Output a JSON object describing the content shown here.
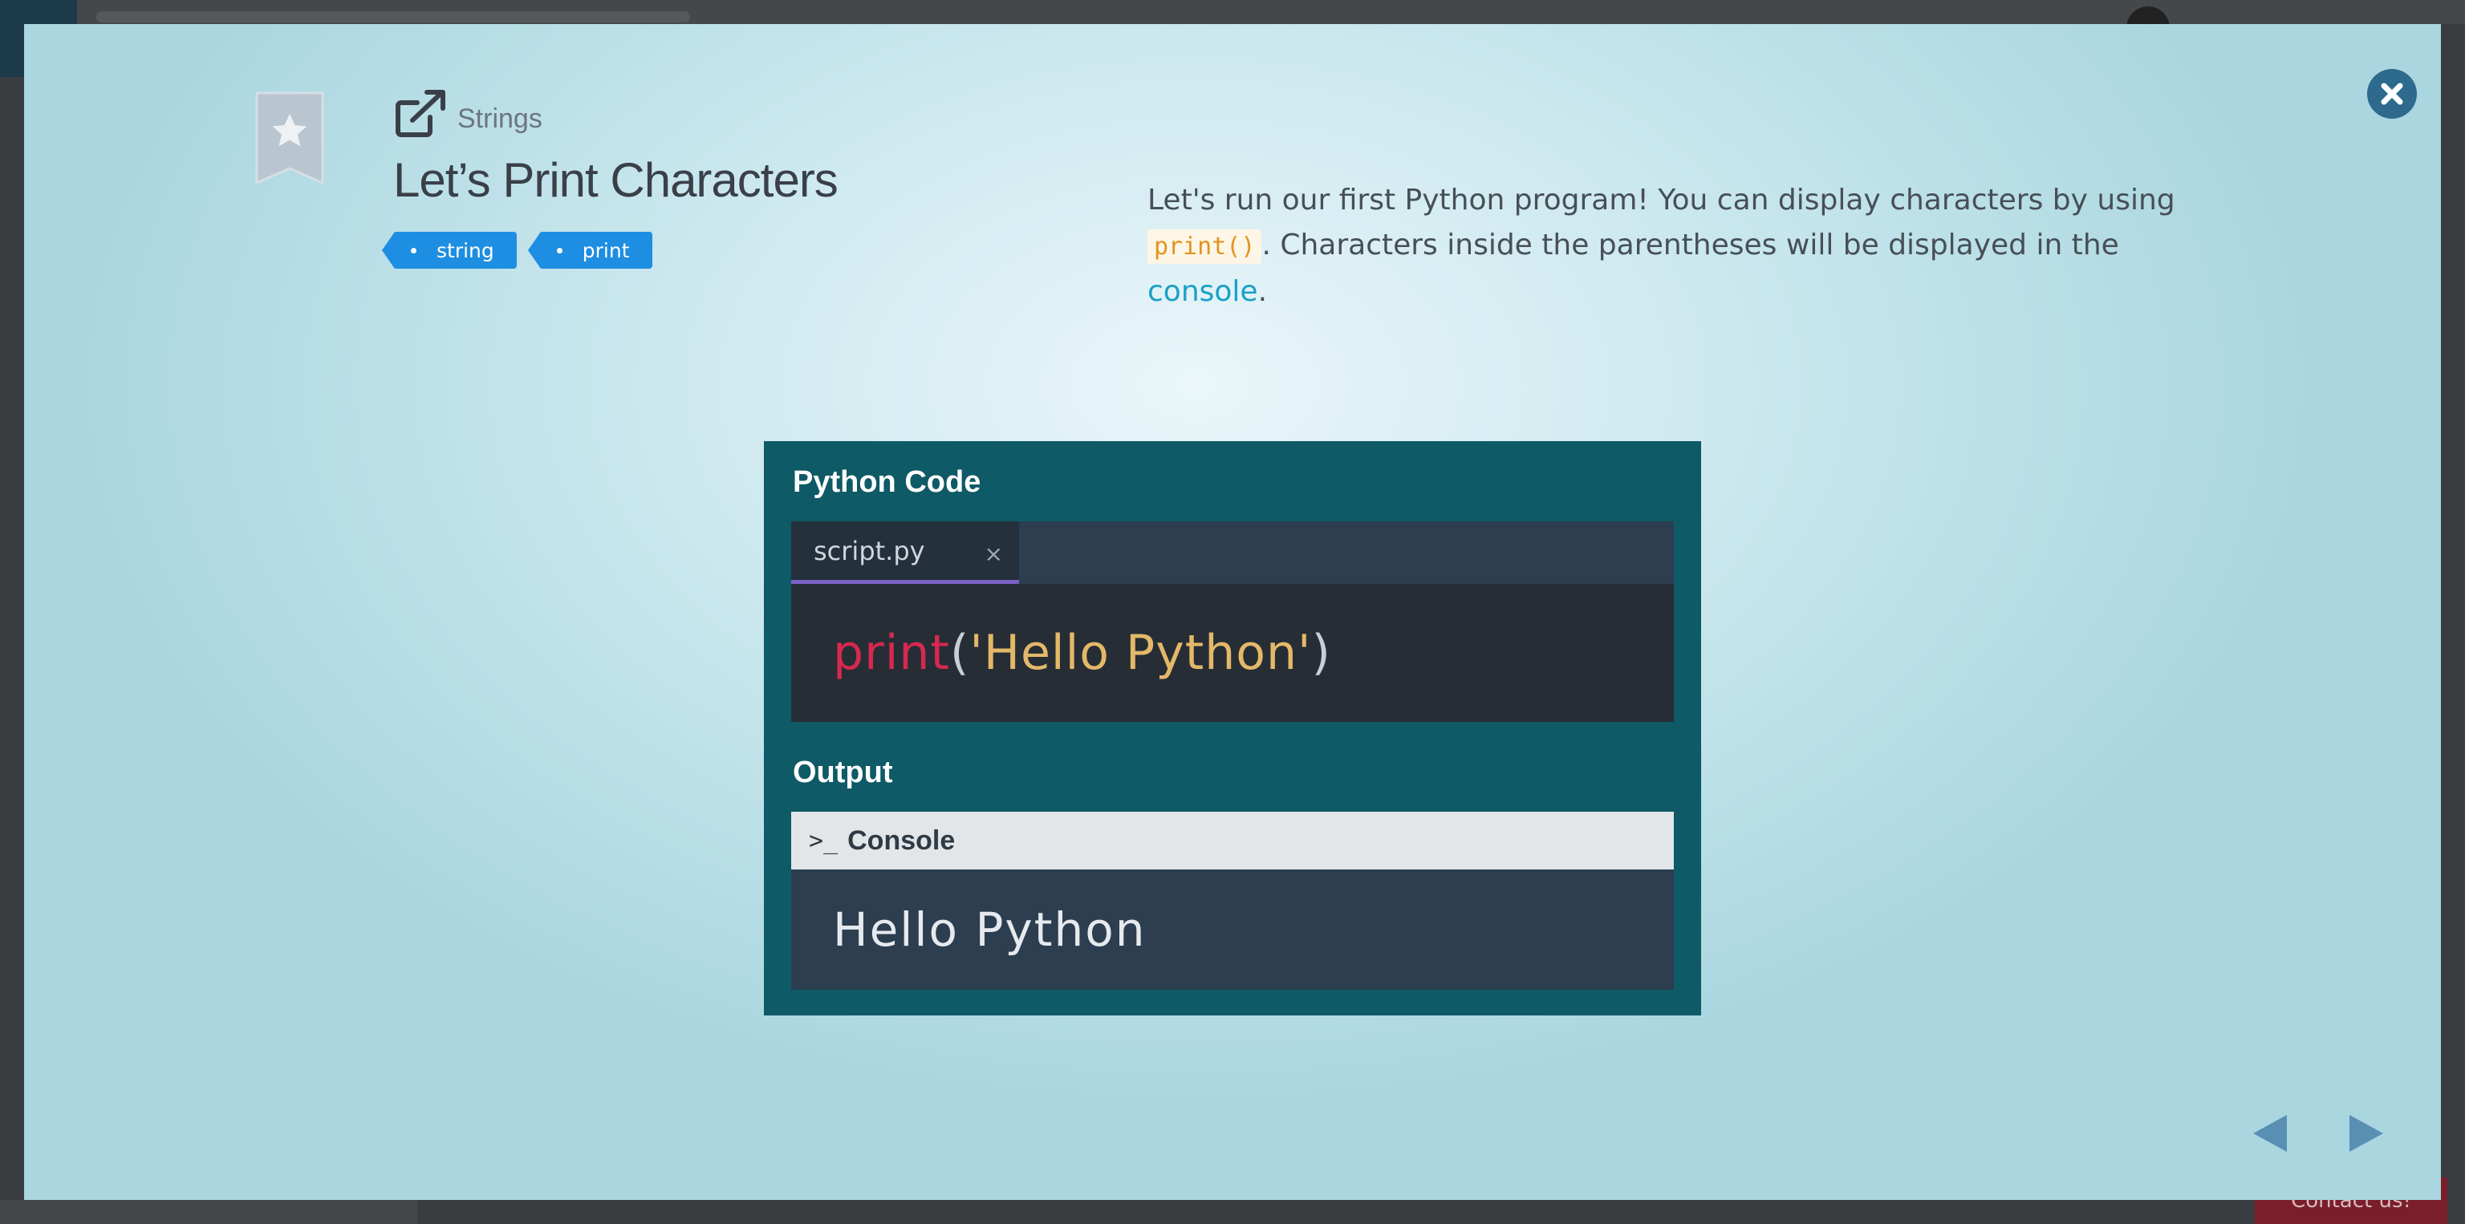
{
  "background": {
    "contact_label": "Contact us!"
  },
  "lesson": {
    "category": "Strings",
    "title": "Let’s Print Characters",
    "tags": [
      "string",
      "print"
    ],
    "description": {
      "part1": "Let's run our first Python program! You can display characters by using ",
      "code": "print()",
      "part2": ". Characters inside the parentheses will be displayed in the ",
      "link": "console",
      "part3": "."
    }
  },
  "illustration": {
    "code_section_label": "Python Code",
    "tab_name": "script.py",
    "tab_close": "×",
    "code": {
      "fn": "print",
      "open_paren": "(",
      "string": "'Hello Python'",
      "close_paren": ")"
    },
    "output_section_label": "Output",
    "console_prompt": ">_",
    "console_label": "Console",
    "console_output": "Hello Python"
  },
  "colors": {
    "accent_blue": "#1d8ee2",
    "close_button": "#2d6a8e",
    "illustration_bg": "#0e5a66",
    "keyword_red": "#d62850",
    "string_yellow": "#e3b868",
    "nav_arrow": "#5a8fb4"
  },
  "icons": {
    "close": "close-icon",
    "bookmark": "bookmark-star-icon",
    "open_external": "external-link-icon",
    "prev": "triangle-left-icon",
    "next": "triangle-right-icon"
  }
}
